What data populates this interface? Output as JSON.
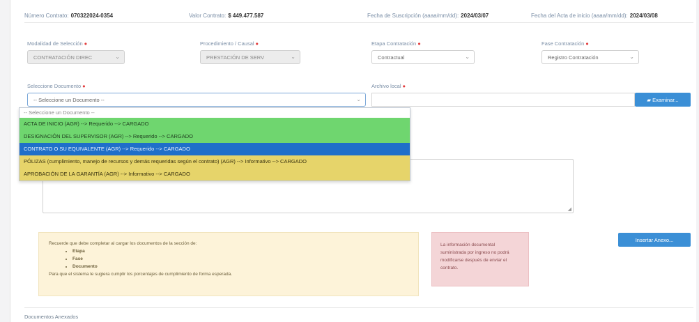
{
  "contract_info": {
    "numero_label": "Número Contrato:",
    "numero_value": "070322024-0354",
    "valor_label": "Valor Contrato:",
    "valor_value": "$ 449.477.587",
    "fecha_suscripcion_label": "Fecha de Suscripción (aaaa/mm/dd):",
    "fecha_suscripcion_value": "2024/03/07",
    "fecha_inicio_label": "Fecha del Acta de inicio (aaaa/mm/dd):",
    "fecha_inicio_value": "2024/03/08"
  },
  "filters": {
    "modalidad_label": "Modalidad de Selección",
    "modalidad_value": "CONTRATACIÓN DIREC",
    "procedimiento_label": "Procedimiento / Causal",
    "procedimiento_value": "PRESTACIÓN DE SERV",
    "etapa_label": "Etapa Contratación",
    "etapa_value": "Contractual",
    "fase_label": "Fase Contratación",
    "fase_value": "Registro Contratación"
  },
  "document_select": {
    "label": "Seleccione Documento",
    "value": "-- Seleccione un Documento --"
  },
  "file_input": {
    "label": "Archivo local",
    "button_label": "Examinar..."
  },
  "dropdown_options": [
    {
      "label": "-- Seleccione un Documento --",
      "style": "placeholder"
    },
    {
      "label": "ACTA DE INICIO (AGR) --> Requerido --> CARGADO",
      "style": "green"
    },
    {
      "label": "DESIGNACIÓN DEL SUPERVISOR (AGR) --> Requerido --> CARGADO",
      "style": "green"
    },
    {
      "label": "CONTRATO O SU EQUIVALENTE (AGR) --> Requerido --> CARGADO",
      "style": "blue"
    },
    {
      "label": "PÓLIZAS (cumplimiento, manejo de recursos y demás requeridas según el contrato) (AGR) --> Informativo --> CARGADO",
      "style": "yellow"
    },
    {
      "label": "APROBACIÓN DE LA GARANTÍA (AGR) --> Informativo --> CARGADO",
      "style": "yellow"
    }
  ],
  "insert_button_label": "Insertar Anexo...",
  "note_yellow": {
    "intro": "Recuerde que debe completar al cargar los documentos de la sección de:",
    "items": [
      "Etapa",
      "Fase",
      "Documento"
    ],
    "footer": "Para que el sistema le sugiera cumplir los porcentajes de cumplimiento de forma esperada."
  },
  "note_red": {
    "text": "La información documental suministrada por ingreso no podrá modificarse después de enviar el contrato."
  },
  "section_footer": "Documentos Anexados",
  "colors": {
    "accent_blue": "#3b8fd6",
    "option_green": "#6fd66f",
    "option_selected": "#1f6fc9",
    "option_yellow": "#e6d46a",
    "required_star": "#e23c3c"
  }
}
